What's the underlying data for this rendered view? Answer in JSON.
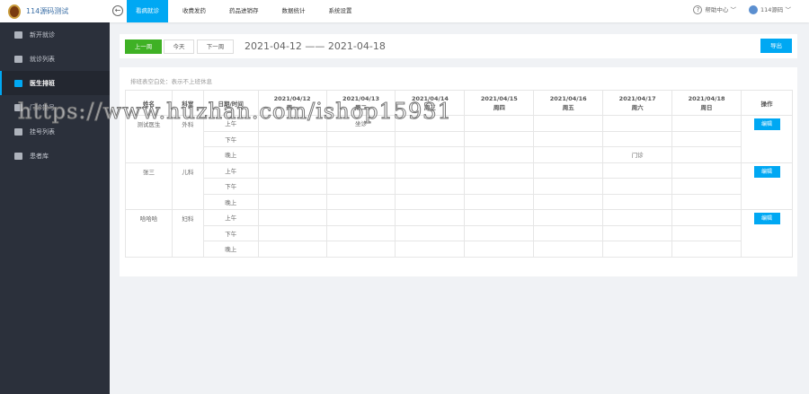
{
  "app": {
    "title": "114源码测试"
  },
  "nav": {
    "tabs": [
      "看病就诊",
      "收费发药",
      "药品进销存",
      "数据统计",
      "系统设置"
    ],
    "help": "帮助中心",
    "user": "114源码"
  },
  "sidebar": {
    "items": [
      "新开就诊",
      "就诊列表",
      "医生排班",
      "门诊挂号",
      "挂号列表",
      "患者库"
    ]
  },
  "toolbar": {
    "prev": "上一周",
    "today": "今天",
    "next": "下一周",
    "range": "2021-04-12 —— 2021-04-18",
    "export": "导出"
  },
  "schedule": {
    "note": "排班表空白处：表示不上班休息",
    "headers": {
      "name": "姓名",
      "dept": "科室",
      "time": "日期/时间",
      "op": "操作"
    },
    "days": [
      {
        "date": "2021/04/12",
        "week": "周一"
      },
      {
        "date": "2021/04/13",
        "week": "周二"
      },
      {
        "date": "2021/04/14",
        "week": "周三"
      },
      {
        "date": "2021/04/15",
        "week": "周四"
      },
      {
        "date": "2021/04/16",
        "week": "周五"
      },
      {
        "date": "2021/04/17",
        "week": "周六"
      },
      {
        "date": "2021/04/18",
        "week": "周日"
      }
    ],
    "periods": [
      "上午",
      "下午",
      "晚上"
    ],
    "edit": "编辑",
    "doctors": [
      {
        "name": "测试医生",
        "dept": "外科",
        "cells": [
          [
            "",
            "坐诊",
            "",
            "",
            "",
            "",
            ""
          ],
          [
            "",
            "",
            "",
            "",
            "",
            "",
            ""
          ],
          [
            "",
            "",
            "",
            "",
            "",
            "门诊",
            ""
          ]
        ]
      },
      {
        "name": "张三",
        "dept": "儿科",
        "cells": [
          [
            "",
            "",
            "",
            "",
            "",
            "",
            ""
          ],
          [
            "",
            "",
            "",
            "",
            "",
            "",
            ""
          ],
          [
            "",
            "",
            "",
            "",
            "",
            "",
            ""
          ]
        ]
      },
      {
        "name": "哈哈哈",
        "dept": "妇科",
        "cells": [
          [
            "",
            "",
            "",
            "",
            "",
            "",
            ""
          ],
          [
            "",
            "",
            "",
            "",
            "",
            "",
            ""
          ],
          [
            "",
            "",
            "",
            "",
            "",
            "",
            ""
          ]
        ]
      }
    ]
  },
  "watermark": "https://www.huzhan.com/ishop15931"
}
